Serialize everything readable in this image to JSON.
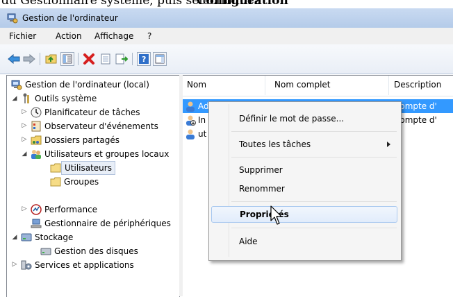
{
  "page_fragment": {
    "text_left": "du Gestionnaire système, puis sélectionnez",
    "text_right": "Configuration"
  },
  "window": {
    "title": "Gestion de l'ordinateur"
  },
  "menubar": {
    "items": [
      "Fichier",
      "Action",
      "Affichage",
      "?"
    ]
  },
  "toolbar": {
    "buttons": [
      "back-icon",
      "forward-icon",
      "up-folder-icon",
      "console-tree-icon",
      "delete-icon",
      "properties-icon",
      "export-icon",
      "help-icon",
      "show-hide-icon"
    ]
  },
  "tree": {
    "items": [
      {
        "label": "Gestion de l'ordinateur (local)",
        "icon": "computer-management-icon"
      },
      {
        "label": "Outils système",
        "icon": "system-tools-icon"
      },
      {
        "label": "Planificateur de tâches",
        "icon": "clock-icon"
      },
      {
        "label": "Observateur d'événements",
        "icon": "event-viewer-icon"
      },
      {
        "label": "Dossiers partagés",
        "icon": "shared-folder-icon"
      },
      {
        "label": "Utilisateurs et groupes locaux",
        "icon": "users-icon"
      },
      {
        "label": "Utilisateurs",
        "icon": "folder-icon"
      },
      {
        "label": "Groupes",
        "icon": "folder-icon"
      },
      {
        "label": "Performance",
        "icon": "performance-icon"
      },
      {
        "label": "Gestionnaire de périphériques",
        "icon": "device-manager-icon"
      },
      {
        "label": "Stockage",
        "icon": "storage-icon"
      },
      {
        "label": "Gestion des disques",
        "icon": "disk-icon"
      },
      {
        "label": "Services et applications",
        "icon": "services-icon"
      }
    ]
  },
  "list": {
    "columns": [
      "Nom",
      "Nom complet",
      "Description"
    ],
    "rows": [
      {
        "name": "Administrat",
        "full_name": "",
        "description": "Compte d'",
        "selected": true
      },
      {
        "name": "In",
        "full_name": "",
        "description": "Compte d'",
        "selected": false
      },
      {
        "name": "ut",
        "full_name": "",
        "description": "",
        "selected": false
      }
    ]
  },
  "context_menu": {
    "items": [
      {
        "label": "Définir le mot de passe...",
        "has_submenu": false
      },
      {
        "label": "Toutes les tâches",
        "has_submenu": true
      },
      {
        "label": "Supprimer",
        "has_submenu": false
      },
      {
        "label": "Renommer",
        "has_submenu": false
      },
      {
        "label": "Propriétés",
        "has_submenu": false,
        "highlighted": true
      },
      {
        "label": "Aide",
        "has_submenu": false
      }
    ]
  },
  "colors": {
    "selection": "#3399ff",
    "titlebar": "#c9daf1"
  }
}
